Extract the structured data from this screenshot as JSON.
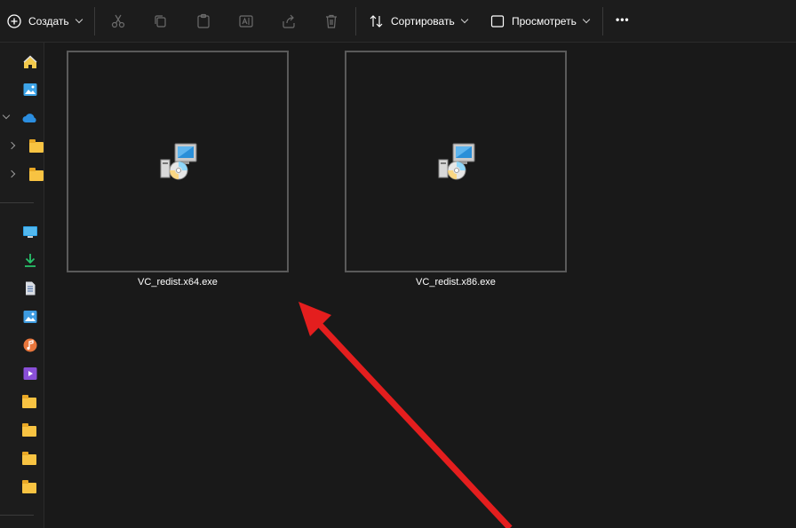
{
  "toolbar": {
    "create_label": "Создать",
    "sort_label": "Сортировать",
    "view_label": "Просмотреть",
    "more_label": "•••"
  },
  "files": [
    {
      "name": "VC_redist.x64.exe",
      "icon": "installer-icon"
    },
    {
      "name": "VC_redist.x86.exe",
      "icon": "installer-icon"
    }
  ],
  "colors": {
    "background": "#191919",
    "toolbar": "#1c1c1c",
    "tile_border": "#5a5a5a",
    "arrow": "#e41e1e",
    "folder": "#f8c342"
  }
}
